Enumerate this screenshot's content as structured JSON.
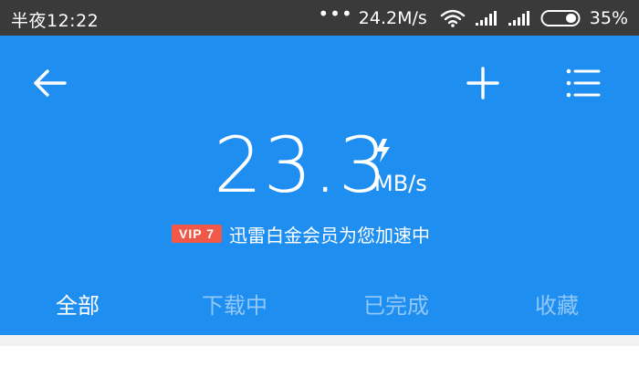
{
  "status_bar": {
    "time": "半夜12:22",
    "dots": "•••",
    "network_speed": "24.2M/s",
    "battery_percent": "35%",
    "icons": [
      "wifi-icon",
      "signal-icon",
      "signal-icon",
      "battery-icon"
    ]
  },
  "header": {
    "back_icon": "back-arrow-icon",
    "add_icon": "plus-icon",
    "menu_icon": "list-menu-icon",
    "speed_value": "23.3",
    "speed_unit": "MB/s",
    "boost_icon": "lightning-icon",
    "vip_badge": "VIP 7",
    "vip_message": "迅雷白金会员为您加速中"
  },
  "tabs": [
    {
      "label": "全部",
      "active": true
    },
    {
      "label": "下载中",
      "active": false
    },
    {
      "label": "已完成",
      "active": false
    },
    {
      "label": "收藏",
      "active": false
    }
  ],
  "colors": {
    "status_bar_bg": "#3a3a3a",
    "header_bg": "#1f8ef1",
    "vip_badge_bg": "#f0584a",
    "content_bg": "#f2f2f2"
  }
}
